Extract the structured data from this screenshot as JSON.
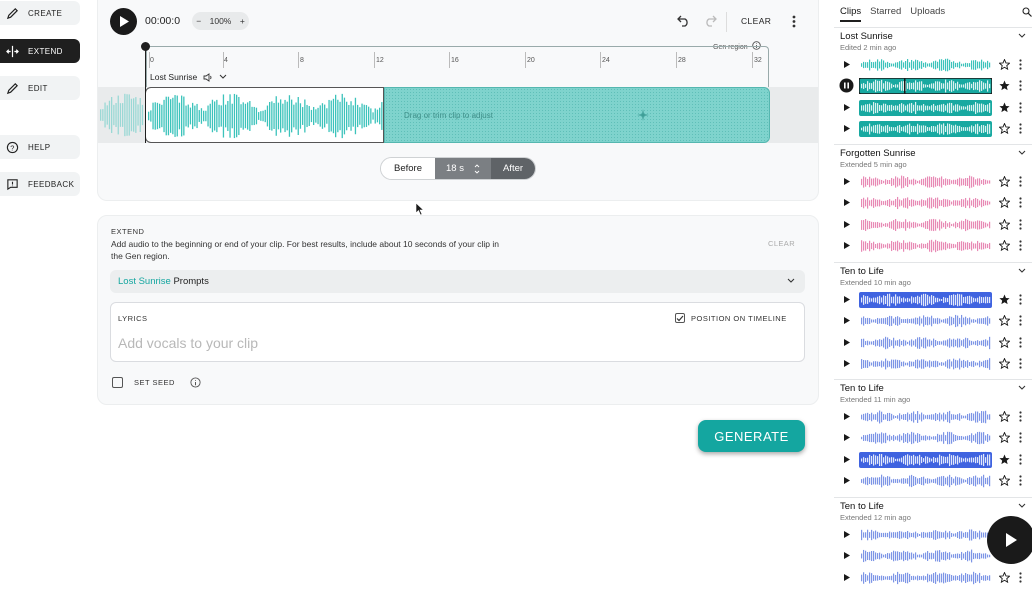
{
  "nav": {
    "items": [
      {
        "label": "CREATE",
        "icon": "pencil-icon",
        "active": false
      },
      {
        "label": "EXTEND",
        "icon": "extend-icon",
        "active": true
      },
      {
        "label": "EDIT",
        "icon": "edit-icon",
        "active": false
      },
      {
        "label": "HELP",
        "icon": "help-icon",
        "active": false
      },
      {
        "label": "FEEDBACK",
        "icon": "feedback-icon",
        "active": false
      }
    ]
  },
  "timeline": {
    "time": "00:00:0",
    "zoom": "100%",
    "zoom_minus": "−",
    "zoom_plus": "+",
    "clear_label": "CLEAR",
    "ruler": [
      "0",
      "4",
      "8",
      "12",
      "16",
      "20",
      "24",
      "28",
      "32"
    ],
    "gen_region_label": "Gen region",
    "clip_name": "Lost Sunrise",
    "drag_hint": "Drag or trim clip to adjust",
    "before_label": "Before",
    "duration": "18 s",
    "after_label": "After"
  },
  "extend": {
    "title": "EXTEND",
    "description": "Add audio to the beginning or end of your clip. For best results, include about 10 seconds of your clip in the Gen region.",
    "clear_label": "CLEAR",
    "prompts_song": "Lost Sunrise",
    "prompts_label": "Prompts",
    "lyrics_label": "LYRICS",
    "position_label": "POSITION ON TIMELINE",
    "position_checked": true,
    "lyrics_placeholder": "Add vocals to your clip",
    "seed_label": "SET SEED",
    "seed_checked": false,
    "generate_label": "GENERATE"
  },
  "panel": {
    "tabs": [
      "Clips",
      "Starred",
      "Uploads"
    ],
    "active_tab": "Clips",
    "groups": [
      {
        "title": "Lost Sunrise",
        "subtitle": "Edited 2 min ago",
        "color": "#3cc3bb",
        "rows": [
          {
            "playing": false,
            "selected": false,
            "starred": false
          },
          {
            "playing": true,
            "selected": true,
            "starred": true
          },
          {
            "playing": false,
            "selected": true,
            "starred": true
          },
          {
            "playing": false,
            "selected": true,
            "starred": false
          }
        ]
      },
      {
        "title": "Forgotten Sunrise",
        "subtitle": "Extended 5 min ago",
        "color": "#e889b5",
        "rows": [
          {
            "playing": false,
            "selected": false,
            "starred": false
          },
          {
            "playing": false,
            "selected": false,
            "starred": false
          },
          {
            "playing": false,
            "selected": false,
            "starred": false
          },
          {
            "playing": false,
            "selected": false,
            "starred": false
          }
        ]
      },
      {
        "title": "Ten to Life",
        "subtitle": "Extended 10 min ago",
        "color": "#7d95e6",
        "rows": [
          {
            "playing": false,
            "selected": true,
            "starred": true
          },
          {
            "playing": false,
            "selected": false,
            "starred": false
          },
          {
            "playing": false,
            "selected": false,
            "starred": false
          },
          {
            "playing": false,
            "selected": false,
            "starred": false
          }
        ]
      },
      {
        "title": "Ten to Life",
        "subtitle": "Extended 11 min ago",
        "color": "#7d95e6",
        "rows": [
          {
            "playing": false,
            "selected": false,
            "starred": false
          },
          {
            "playing": false,
            "selected": false,
            "starred": false
          },
          {
            "playing": false,
            "selected": true,
            "starred": true
          },
          {
            "playing": false,
            "selected": false,
            "starred": false
          }
        ]
      },
      {
        "title": "Ten to Life",
        "subtitle": "Extended 12 min ago",
        "color": "#7d95e6",
        "rows": [
          {
            "playing": false,
            "selected": false,
            "starred": false
          },
          {
            "playing": false,
            "selected": false,
            "starred": false
          },
          {
            "playing": false,
            "selected": false,
            "starred": false
          }
        ]
      }
    ]
  },
  "colors": {
    "accent": "#14a6a0",
    "clip_teal": "#3cc3bb",
    "pink": "#e889b5",
    "blue": "#7d95e6",
    "blue_selected": "#3f63e0"
  }
}
